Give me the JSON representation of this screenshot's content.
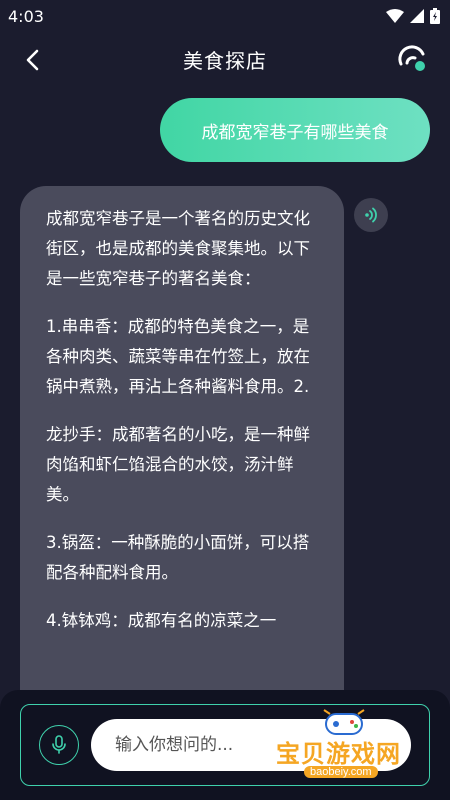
{
  "status_bar": {
    "time": "4:03"
  },
  "header": {
    "title": "美食探店"
  },
  "chat": {
    "user_message": "成都宽窄巷子有哪些美食",
    "ai_paragraphs": [
      "成都宽窄巷子是一个著名的历史文化街区，也是成都的美食聚集地。以下是一些宽窄巷子的著名美食：",
      "1.串串香：成都的特色美食之一，是各种肉类、蔬菜等串在竹签上，放在锅中煮熟，再沾上各种酱料食用。2.",
      "龙抄手：成都著名的小吃，是一种鲜肉馅和虾仁馅混合的水饺，汤汁鲜美。",
      "3.锅盔：一种酥脆的小面饼，可以搭配各种配料食用。",
      "4.钵钵鸡：成都有名的凉菜之一"
    ]
  },
  "input": {
    "placeholder": "输入你想问的..."
  },
  "watermark": {
    "name": "宝贝游戏网",
    "url": "baobeiy.com"
  },
  "colors": {
    "background": "#1b1c2e",
    "accent": "#3fd1ac",
    "ai_bubble": "#4a4b5c",
    "panel": "#101221"
  }
}
